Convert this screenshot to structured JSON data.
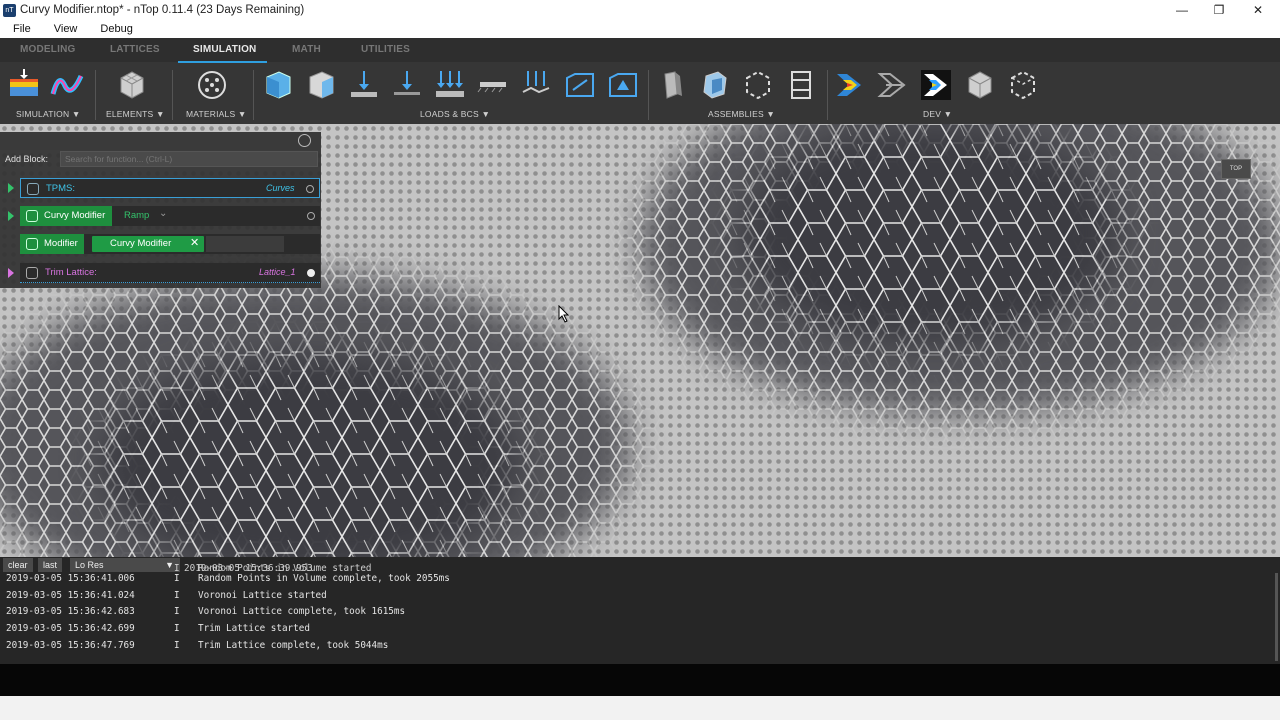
{
  "window": {
    "title": "Curvy Modifier.ntop* - nTop 0.11.4 (23 Days Remaining)",
    "app_icon": "ntop-logo-icon",
    "controls": [
      "minimize-icon",
      "maximize-icon",
      "close-icon"
    ]
  },
  "menu": {
    "file": "File",
    "view": "View",
    "debug": "Debug"
  },
  "ribbon": {
    "tabs": {
      "modeling": "MODELING",
      "lattices": "LATTICES",
      "simulation": "SIMULATION",
      "math": "MATH",
      "utilities": "UTILITIES"
    },
    "active_tab": "SIMULATION",
    "accent_color": "#2f9fe0",
    "groups": {
      "simulation": "SIMULATION",
      "elements": "ELEMENTS",
      "materials": "MATERIALS",
      "loads": "LOADS & BCS",
      "assemblies": "ASSEMBLIES",
      "dev": "DEV"
    },
    "dropdown_glyph": "▼"
  },
  "panel": {
    "add_block_label": "Add Block:",
    "search_placeholder": "Search for function... (Ctrl-L)",
    "rows": {
      "tpms": {
        "label": "TPMS:",
        "right": "Curves",
        "color": "#3fc3e8"
      },
      "curvy": {
        "label": "Curvy Modifier",
        "option": "Ramp"
      },
      "modifier": {
        "label": "Modifier",
        "chip": "Curvy Modifier"
      },
      "trim": {
        "label": "Trim Lattice:",
        "right": "Lattice_1",
        "color": "#d874e0"
      }
    }
  },
  "viewport": {
    "view_cube_label": "TOP"
  },
  "console": {
    "buttons": {
      "clear": "clear",
      "last": "last",
      "resolution": "Lo Res"
    },
    "partial_line": {
      "time": "2019-03-05 15:36:39.953",
      "level": "I",
      "message": "Random Points in Volume started"
    },
    "lines": [
      {
        "time": "2019-03-05 15:36:41.006",
        "level": "I",
        "message": "Random Points in Volume complete, took 2055ms"
      },
      {
        "time": "2019-03-05 15:36:41.024",
        "level": "I",
        "message": "Voronoi Lattice started"
      },
      {
        "time": "2019-03-05 15:36:42.683",
        "level": "I",
        "message": "Voronoi Lattice complete, took 1615ms"
      },
      {
        "time": "2019-03-05 15:36:42.699",
        "level": "I",
        "message": "Trim Lattice started"
      },
      {
        "time": "2019-03-05 15:36:47.769",
        "level": "I",
        "message": "Trim Lattice complete, took 5044ms"
      }
    ]
  }
}
